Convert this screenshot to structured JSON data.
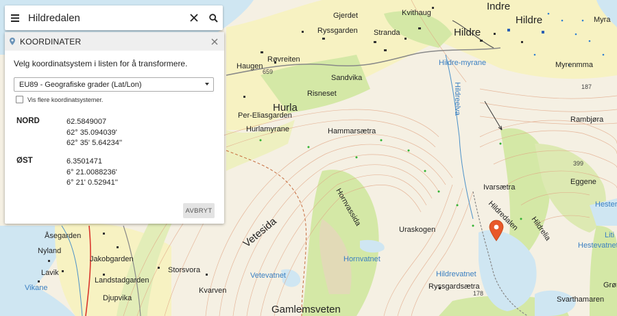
{
  "search": {
    "value": "Hildredalen"
  },
  "panel": {
    "title": "KOORDINATER",
    "description": "Velg koordinatsystem i listen for å transformere.",
    "selected_system": "EU89 - Geografiske grader (Lat/Lon)",
    "checkbox_label": "Vis flere koordinatsystemer.",
    "nord": {
      "label": "NORD",
      "values": [
        "62.5849007",
        "62° 35.094039'",
        "62° 35' 5.64234''"
      ]
    },
    "ost": {
      "label": "ØST",
      "values": [
        "6.3501471",
        "6° 21.0088236'",
        "6° 21' 0.52941''"
      ]
    },
    "cancel_label": "AVBRYT"
  },
  "map": {
    "places": [
      "Gjerdet",
      "Kvithaug",
      "Indre",
      "Hildre",
      "Myra",
      "Ryssgarden",
      "Stranda",
      "Hildre",
      "Røvreiten",
      "Haugen",
      "Sandvika",
      "Hildre-myrane",
      "Myrenmma",
      "Risneset",
      "Hildreelva",
      "Per-Eliasgarden",
      "Hurla",
      "Hurlamyrane",
      "Hammarsætra",
      "Rambjøra",
      "Eggene",
      "Ivarsætra",
      "Hildredalen",
      "Hildrelia",
      "Hestevatnet",
      "Vetesida",
      "Hornvassida",
      "Uraskogen",
      "Hornvatnet",
      "Hildrevatnet",
      "Ryssgardsætra",
      "Åsegarden",
      "Nyland",
      "Jakobgarden",
      "Lavik",
      "Landstadgarden",
      "Djupvika",
      "Vikane",
      "Storsvora",
      "Vetevatnet",
      "Kvarven",
      "Gamlemsveten",
      "Svarthamaren",
      "Hester",
      "Liti",
      "Grøn"
    ],
    "elevations": [
      "659",
      "187",
      "399",
      "178"
    ]
  },
  "colors": {
    "marker": "#e8582a",
    "water": "#cfe6f2",
    "green": "#d4e8a6",
    "field": "#f7f2c2"
  }
}
